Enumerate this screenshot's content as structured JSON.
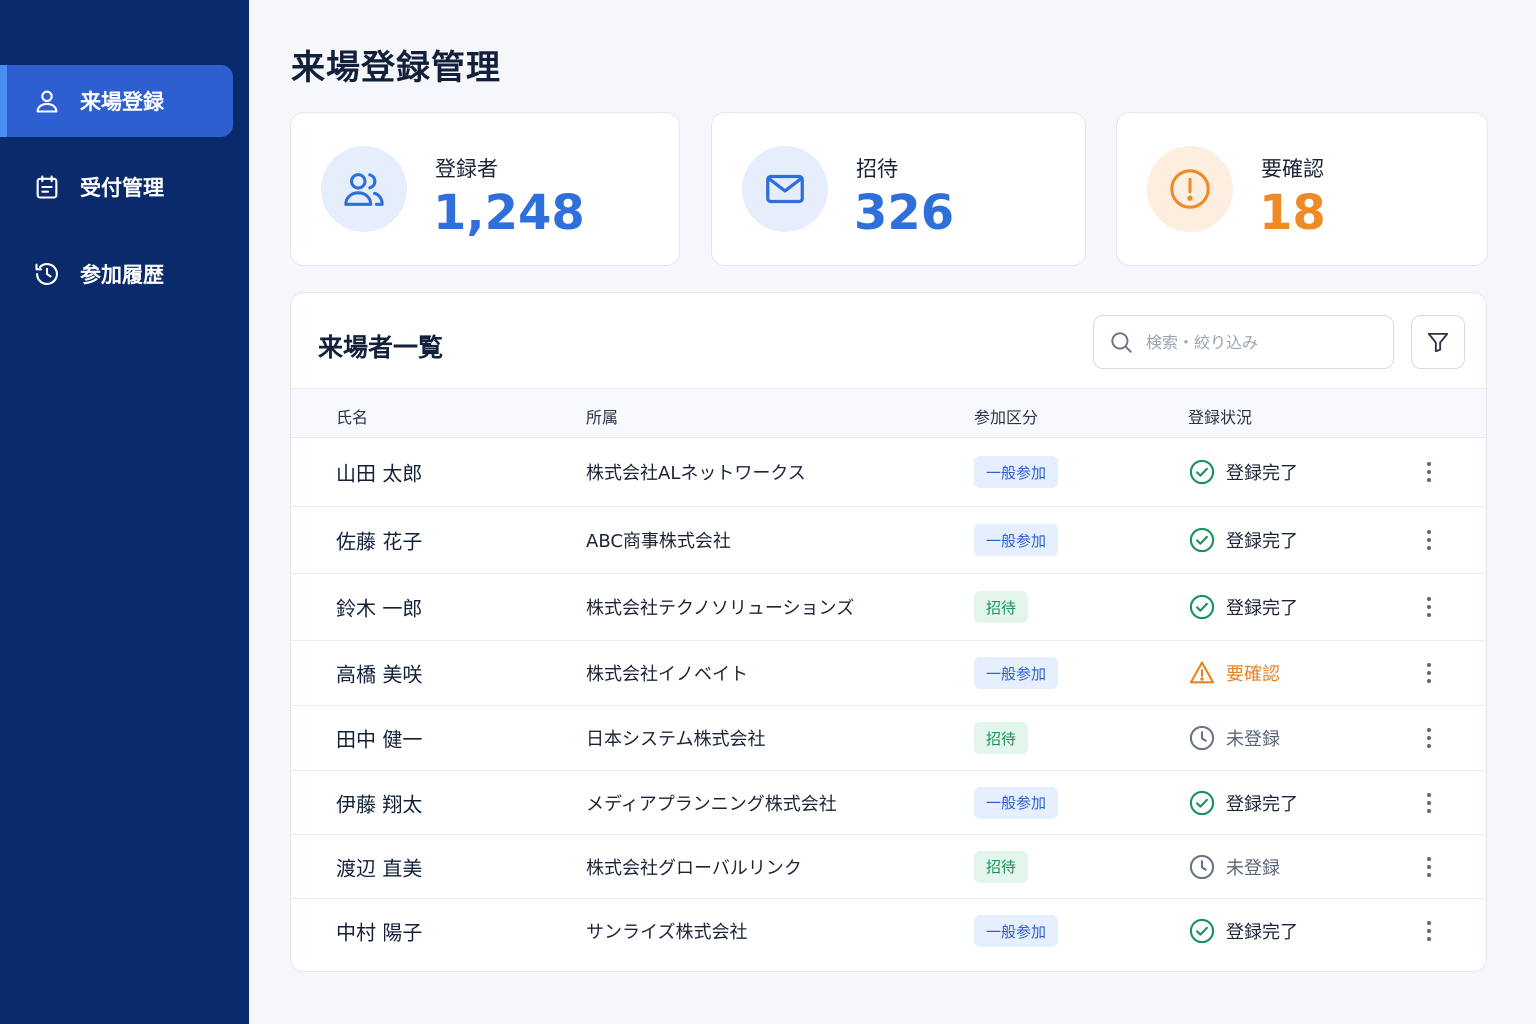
{
  "sidebar": {
    "items": [
      {
        "label": "来場登録",
        "icon": "user-icon",
        "active": true
      },
      {
        "label": "受付管理",
        "icon": "calendar-checklist-icon",
        "active": false
      },
      {
        "label": "参加履歴",
        "icon": "history-icon",
        "active": false
      }
    ]
  },
  "page": {
    "title": "来場登録管理"
  },
  "stats": [
    {
      "label": "登録者",
      "value": "1,248",
      "icon": "users-icon",
      "color": "#2e6fdc",
      "icon_bg": "#e6eefb"
    },
    {
      "label": "招待",
      "value": "326",
      "icon": "mail-icon",
      "color": "#2e6fdc",
      "icon_bg": "#e6eefb"
    },
    {
      "label": "要確認",
      "value": "18",
      "icon": "alert-circle-icon",
      "color": "#f08a24",
      "icon_bg": "#fdeedf"
    }
  ],
  "table": {
    "title": "来場者一覧",
    "search": {
      "placeholder": "検索・絞り込み"
    },
    "columns": [
      "氏名",
      "所属",
      "参加区分",
      "登録状況"
    ],
    "rows": [
      {
        "name": "山田 太郎",
        "org": "株式会社ALネットワークス",
        "type": "一般参加",
        "type_kind": "general",
        "status": "登録完了",
        "status_kind": "done"
      },
      {
        "name": "佐藤 花子",
        "org": "ABC商事株式会社",
        "type": "一般参加",
        "type_kind": "general",
        "status": "登録完了",
        "status_kind": "done"
      },
      {
        "name": "鈴木 一郎",
        "org": "株式会社テクノソリューションズ",
        "type": "招待",
        "type_kind": "invite",
        "status": "登録完了",
        "status_kind": "done"
      },
      {
        "name": "高橋 美咲",
        "org": "株式会社イノベイト",
        "type": "一般参加",
        "type_kind": "general",
        "status": "要確認",
        "status_kind": "check"
      },
      {
        "name": "田中 健一",
        "org": "日本システム株式会社",
        "type": "招待",
        "type_kind": "invite",
        "status": "未登録",
        "status_kind": "pending"
      },
      {
        "name": "伊藤 翔太",
        "org": "メディアプランニング株式会社",
        "type": "一般参加",
        "type_kind": "general",
        "status": "登録完了",
        "status_kind": "done"
      },
      {
        "name": "渡辺 直美",
        "org": "株式会社グローバルリンク",
        "type": "招待",
        "type_kind": "invite",
        "status": "未登録",
        "status_kind": "pending"
      },
      {
        "name": "中村 陽子",
        "org": "サンライズ株式会社",
        "type": "一般参加",
        "type_kind": "general",
        "status": "登録完了",
        "status_kind": "done"
      }
    ]
  },
  "colors": {
    "sidebar_bg": "#0a2a6b",
    "accent": "#2e5fd0",
    "status_done": "#18915a",
    "status_check": "#e8821e",
    "status_pending": "#6b7385"
  }
}
